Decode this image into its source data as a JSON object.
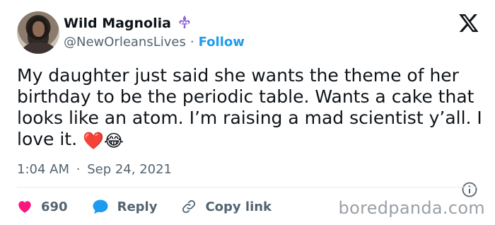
{
  "author": {
    "display_name": "Wild Magnolia",
    "badge_icon": "fleur-de-lis-icon",
    "badge_color": "#8e6bd6",
    "handle": "@NewOrleansLives",
    "separator": "·",
    "follow_label": "Follow"
  },
  "tweet": {
    "text": "My daughter just said she wants the theme of her birthday to be the periodic table. Wants a cake that looks like an atom. I’m raising a mad scientist y’all. I love it.",
    "emojis": [
      "❤️",
      "😂"
    ],
    "time": "1:04 AM",
    "date_separator": "·",
    "date": "Sep 24, 2021"
  },
  "actions": {
    "like_count": "690",
    "reply_label": "Reply",
    "copy_label": "Copy link"
  },
  "watermark": "boredpanda.com",
  "colors": {
    "accent": "#1d9bf0",
    "like": "#f91880",
    "reply": "#1d9bf0",
    "muted": "#536471"
  }
}
